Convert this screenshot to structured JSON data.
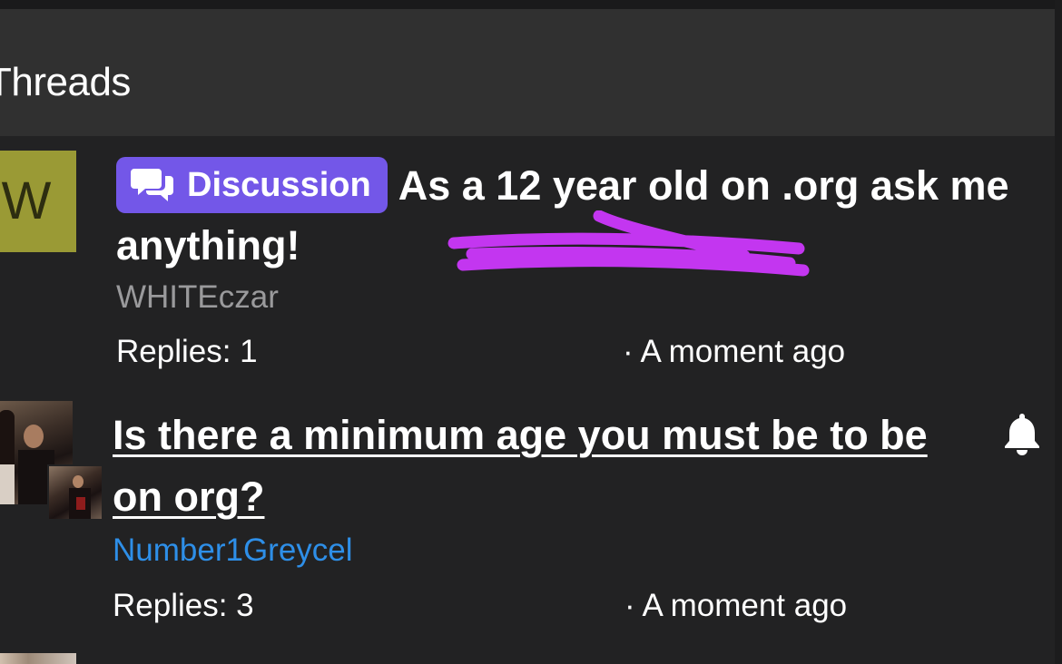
{
  "header": {
    "title": "Threads"
  },
  "threads": [
    {
      "avatar_letter": "W",
      "avatar_color": "#9a9a35",
      "badge": {
        "label": "Discussion",
        "icon": "chat-bubbles-icon",
        "color": "#7357e8"
      },
      "title": "As a 12 year old on .org ask me anything!",
      "author": "WHITEczar",
      "replies": "Replies: 1",
      "time": "· A moment ago",
      "annotation": "purple scribble mark"
    },
    {
      "avatar": "photo avatar",
      "title": "Is there a minimum age you must be to be on org?",
      "author": "Number1Greycel",
      "author_color": "#2e8fe8",
      "replies": "Replies: 3",
      "time": "· A moment ago",
      "watch_icon": "bell-icon"
    }
  ],
  "colors": {
    "background": "#222223",
    "header_background": "#303030",
    "badge": "#7357e8",
    "scribble": "#c336f0",
    "muted_text": "#9a9a9c",
    "link_blue": "#2e8fe8"
  }
}
